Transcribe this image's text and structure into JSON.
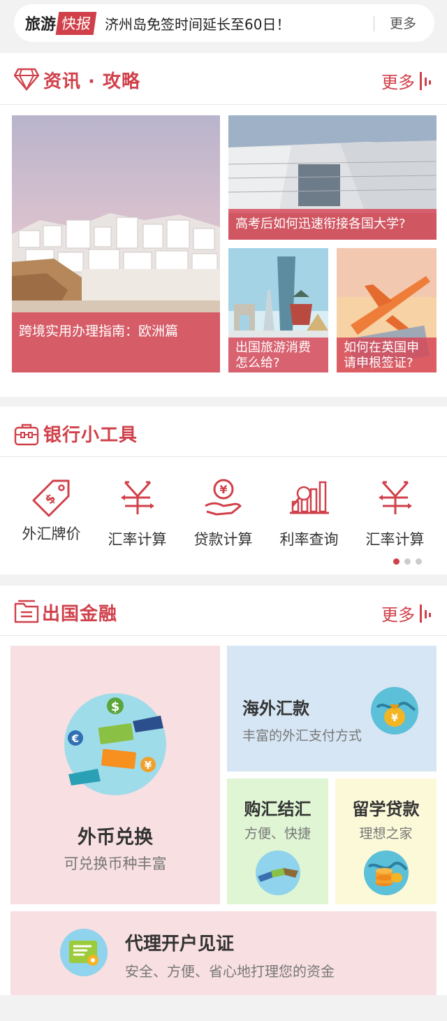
{
  "ticker": {
    "brand": "旅游",
    "badge": "快报",
    "text": "济州岛免签时间延长至60日！",
    "more": "更多"
  },
  "news": {
    "title": "资讯 · 攻略",
    "more": "更多",
    "articles": [
      {
        "caption": "跨境实用办理指南：欧洲篇"
      },
      {
        "caption": "高考后如何迅速衔接各国大学?"
      },
      {
        "caption": "出国旅游消费怎么给?"
      },
      {
        "caption": "如何在英国申请申根签证?"
      }
    ]
  },
  "tools": {
    "title": "银行小工具",
    "items": [
      {
        "label": "外汇牌价",
        "icon": "price-tag-icon"
      },
      {
        "label": "汇率计算",
        "icon": "yen-icon"
      },
      {
        "label": "贷款计算",
        "icon": "coin-hand-icon"
      },
      {
        "label": "利率查询",
        "icon": "bar-chart-icon"
      },
      {
        "label": "汇率计算",
        "icon": "yen-icon"
      }
    ],
    "pages": 3,
    "current_page": 1
  },
  "finance": {
    "title": "出国金融",
    "more": "更多",
    "exchange": {
      "title": "外币兑换",
      "subtitle": "可兑换币种丰富"
    },
    "remit": {
      "title": "海外汇款",
      "subtitle": "丰富的外汇支付方式"
    },
    "buy": {
      "title": "购汇结汇",
      "subtitle": "方便、快捷"
    },
    "loan": {
      "title": "留学贷款",
      "subtitle": "理想之家"
    },
    "account": {
      "title": "代理开户见证",
      "subtitle": "安全、方便、省心地打理您的资金"
    }
  },
  "colors": {
    "accent": "#d0404a",
    "pink": "#f8dfe2",
    "blue": "#d6e6f5",
    "green": "#dff5d3",
    "yellow": "#fbf9d8"
  }
}
